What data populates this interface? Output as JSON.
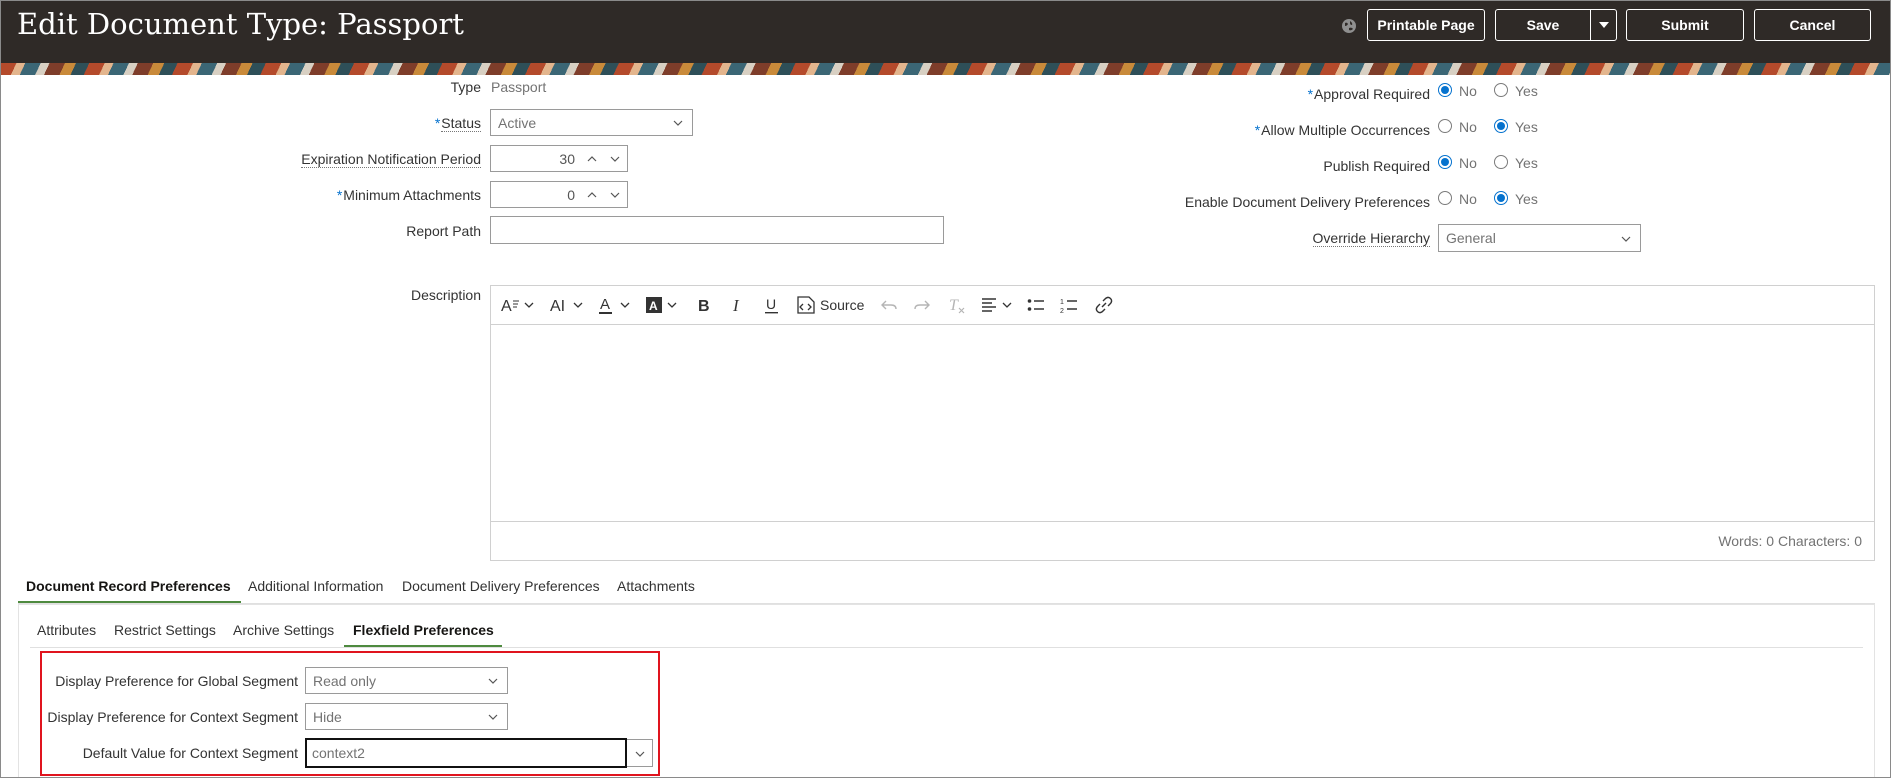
{
  "header": {
    "title": "Edit Document Type: Passport",
    "printable_page": "Printable Page",
    "save": "Save",
    "submit": "Submit",
    "cancel": "Cancel"
  },
  "form": {
    "type": {
      "label": "Type",
      "value": "Passport"
    },
    "status": {
      "label": "Status",
      "value": "Active",
      "required": true
    },
    "expiration_notification_period": {
      "label": "Expiration Notification Period",
      "value": "30"
    },
    "minimum_attachments": {
      "label": "Minimum Attachments",
      "value": "0",
      "required": true
    },
    "report_path": {
      "label": "Report Path",
      "value": ""
    },
    "approval_required": {
      "label": "Approval Required",
      "selected": "No",
      "required": true
    },
    "allow_multiple_occurrences": {
      "label": "Allow Multiple Occurrences",
      "selected": "Yes",
      "required": true
    },
    "publish_required": {
      "label": "Publish Required",
      "selected": "No"
    },
    "enable_document_delivery_preferences": {
      "label": "Enable Document Delivery Preferences",
      "selected": "Yes"
    },
    "radio_options": {
      "no": "No",
      "yes": "Yes"
    },
    "override_hierarchy": {
      "label": "Override Hierarchy",
      "value": "General"
    },
    "description": {
      "label": "Description"
    }
  },
  "editor": {
    "source_label": "Source",
    "word_count": "Words: 0 Characters: 0"
  },
  "tabs": [
    {
      "label": "Document Record Preferences",
      "active": true
    },
    {
      "label": "Additional Information",
      "active": false
    },
    {
      "label": "Document Delivery Preferences",
      "active": false
    },
    {
      "label": "Attachments",
      "active": false
    }
  ],
  "subtabs": [
    {
      "label": "Attributes",
      "active": false
    },
    {
      "label": "Restrict Settings",
      "active": false
    },
    {
      "label": "Archive Settings",
      "active": false
    },
    {
      "label": "Flexfield Preferences",
      "active": true
    }
  ],
  "flexfield": {
    "global_segment": {
      "label": "Display Preference for Global Segment",
      "value": "Read only"
    },
    "context_segment": {
      "label": "Display Preference for Context Segment",
      "value": "Hide"
    },
    "default_context": {
      "label": "Default Value for Context Segment",
      "value": "context2"
    }
  },
  "colors": {
    "header_bg": "#2f2a27",
    "accent_blue": "#0572ce",
    "tab_underline": "#4e8a3f",
    "highlight": "#e0141e"
  }
}
